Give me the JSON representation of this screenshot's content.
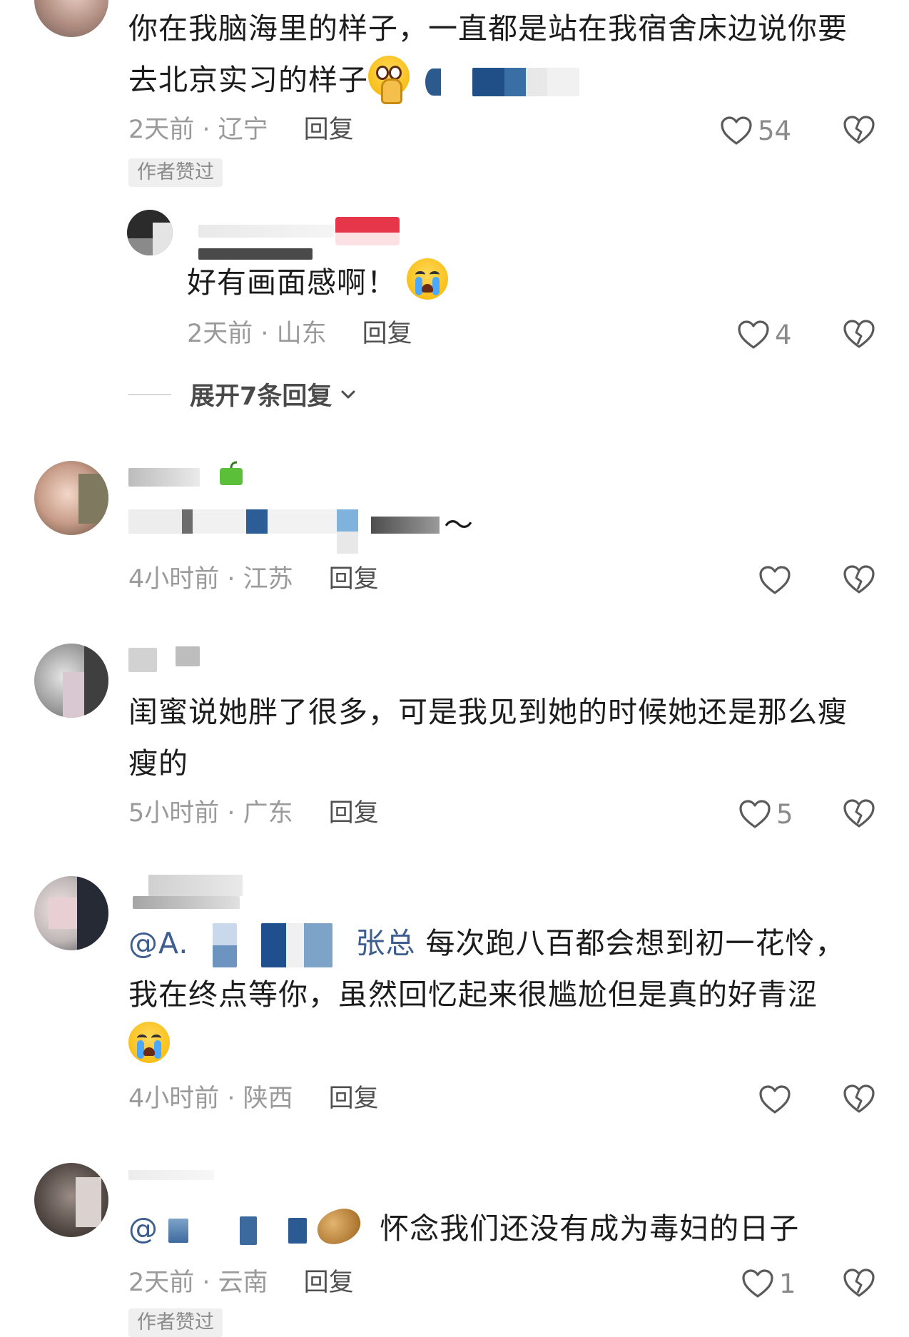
{
  "comments": [
    {
      "line1": "你在我脑海里的样子，一直都是站在我宿舍床边说你要",
      "line2": "去北京实习的样子",
      "meta": "2天前 · 辽宁",
      "reply": "回复",
      "likes": "54",
      "badge": "作者赞过"
    },
    {
      "content": "好有画面感啊！",
      "meta": "2天前 · 山东",
      "reply": "回复",
      "likes": "4"
    },
    {
      "expand": "展开7条回复",
      "content_tail": "～",
      "meta": "4小时前 · 江苏",
      "reply": "回复"
    },
    {
      "line1": "闺蜜说她胖了很多，可是我见到她的时候她还是那么瘦",
      "line2": "瘦的",
      "meta": "5小时前 · 广东",
      "reply": "回复",
      "likes": "5"
    },
    {
      "mention": "@A.",
      "mention_tail": "张总",
      "line1": "每次跑八百都会想到初一花怜，",
      "line2": "我在终点等你，虽然回忆起来很尴尬但是真的好青涩",
      "meta": "4小时前 · 陕西",
      "reply": "回复"
    },
    {
      "mention": "@",
      "line1": "怀念我们还没有成为毒妇的日子",
      "meta": "2天前 · 云南",
      "reply": "回复",
      "likes": "1",
      "badge": "作者赞过"
    }
  ],
  "icons": {
    "like": "heart-outline-icon",
    "dislike": "broken-heart-icon",
    "expand": "chevron-down-icon"
  },
  "colors": {
    "mention": "#3d5e8e",
    "meta_gray": "#9a9a9a",
    "badge_bg": "#efefef"
  }
}
